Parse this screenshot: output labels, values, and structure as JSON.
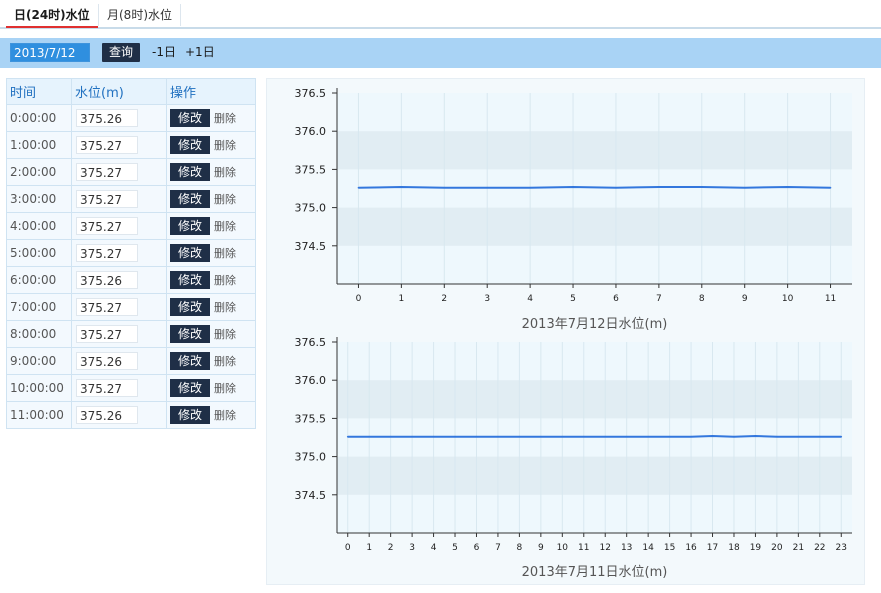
{
  "tabs": [
    {
      "label": "日(24时)水位",
      "active": true
    },
    {
      "label": "月(8时)水位",
      "active": false
    }
  ],
  "query": {
    "date": "2013/7/12",
    "query_label": "查询",
    "prev_label": "-1日",
    "next_label": "+1日"
  },
  "table": {
    "headers": [
      "时间",
      "水位(m)",
      "操作"
    ],
    "edit_label": "修改",
    "delete_label": "删除",
    "rows": [
      {
        "time": "0:00:00",
        "value": "375.26"
      },
      {
        "time": "1:00:00",
        "value": "375.27"
      },
      {
        "time": "2:00:00",
        "value": "375.27"
      },
      {
        "time": "3:00:00",
        "value": "375.27"
      },
      {
        "time": "4:00:00",
        "value": "375.27"
      },
      {
        "time": "5:00:00",
        "value": "375.27"
      },
      {
        "time": "6:00:00",
        "value": "375.26"
      },
      {
        "time": "7:00:00",
        "value": "375.27"
      },
      {
        "time": "8:00:00",
        "value": "375.27"
      },
      {
        "time": "9:00:00",
        "value": "375.26"
      },
      {
        "time": "10:00:00",
        "value": "375.27"
      },
      {
        "time": "11:00:00",
        "value": "375.26"
      }
    ]
  },
  "colors": {
    "line": "#3377dd",
    "band": "#e1edf3",
    "plot_bg": "#eef8fd"
  },
  "chart_data": [
    {
      "type": "line",
      "title": "2013年7月12日水位(m)",
      "x": [
        0,
        1,
        2,
        3,
        4,
        5,
        6,
        7,
        8,
        9,
        10,
        11
      ],
      "series": [
        {
          "values": [
            375.26,
            375.27,
            375.26,
            375.26,
            375.26,
            375.27,
            375.26,
            375.27,
            375.27,
            375.26,
            375.27,
            375.26
          ]
        }
      ],
      "ylim": [
        374.0,
        376.5
      ],
      "yticks": [
        "374.5",
        "375.0",
        "375.5",
        "376.0",
        "376.5"
      ],
      "grid": true
    },
    {
      "type": "line",
      "title": "2013年7月11日水位(m)",
      "x": [
        0,
        1,
        2,
        3,
        4,
        5,
        6,
        7,
        8,
        9,
        10,
        11,
        12,
        13,
        14,
        15,
        16,
        17,
        18,
        19,
        20,
        21,
        22,
        23
      ],
      "series": [
        {
          "values": [
            375.26,
            375.26,
            375.26,
            375.26,
            375.26,
            375.26,
            375.26,
            375.26,
            375.26,
            375.26,
            375.26,
            375.26,
            375.26,
            375.26,
            375.26,
            375.26,
            375.26,
            375.27,
            375.26,
            375.27,
            375.26,
            375.26,
            375.26,
            375.26
          ]
        }
      ],
      "ylim": [
        374.0,
        376.5
      ],
      "yticks": [
        "374.5",
        "375.0",
        "375.5",
        "376.0",
        "376.5"
      ],
      "grid": true
    }
  ]
}
